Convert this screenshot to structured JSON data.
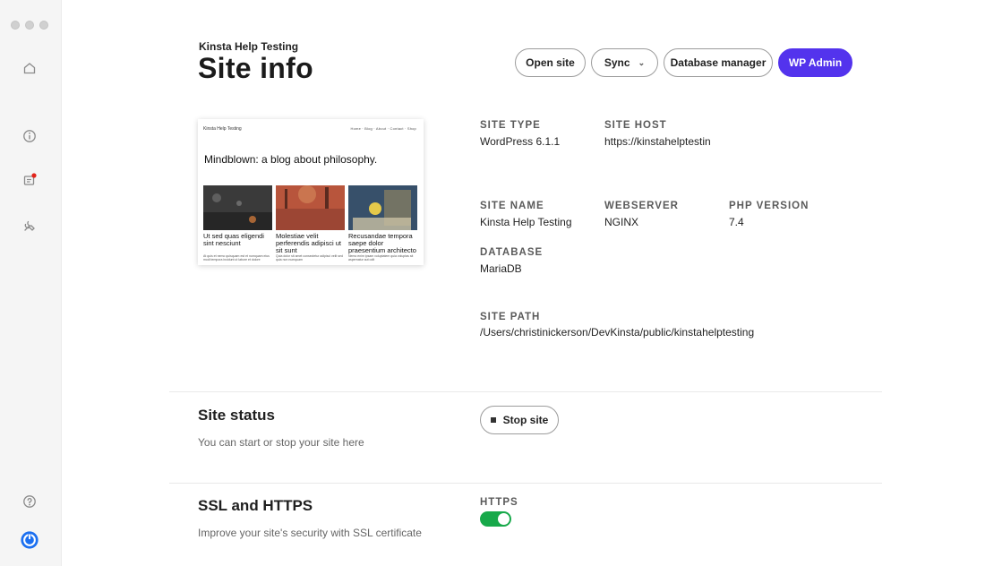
{
  "window": {
    "title": "Kinsta Help Testing — Site info"
  },
  "sidebar": {
    "items": [
      {
        "icon": "home-icon"
      },
      {
        "icon": "info-icon"
      },
      {
        "icon": "sites-icon",
        "badge": true
      },
      {
        "icon": "tools-icon"
      },
      {
        "icon": "help-icon"
      },
      {
        "icon": "kinsta-logo-icon"
      }
    ]
  },
  "header": {
    "breadcrumb": "Kinsta Help Testing",
    "title": "Site info"
  },
  "actions": {
    "open_site": "Open site",
    "sync": "Sync",
    "database_manager": "Database manager",
    "wp_admin": "WP Admin"
  },
  "preview": {
    "site_title": "Kinsta Help Testing",
    "nav_text": "Home  ·  Blog  ·  About  ·  Contact  ·  Shop",
    "headline": "Mindblown: a blog about philosophy.",
    "posts": [
      {
        "title": "Ut sed quas eligendi sint nesciunt",
        "excerpt": "At quis et nemo quisquam est et numquam eius modi tempora incidunt ut labore et dolore"
      },
      {
        "title": "Molestiae velit perferendis adipisci ut sit sunt",
        "excerpt": "Quia dolor sit amet consectetur adipisci velit sed quia non numquam"
      },
      {
        "title": "Recusandae tempora saepe dolor praesentium architecto",
        "excerpt": "Nemo enim ipsam voluptatem quia voluptas sit aspernatur aut odit"
      }
    ]
  },
  "info": {
    "site_type": {
      "label": "SITE TYPE",
      "value": "WordPress 6.1.1"
    },
    "site_host": {
      "label": "SITE HOST",
      "value": "https://kinstahelptestin"
    },
    "site_name": {
      "label": "SITE NAME",
      "value": "Kinsta Help Testing"
    },
    "webserver": {
      "label": "WEBSERVER",
      "value": "NGINX"
    },
    "php_version": {
      "label": "PHP VERSION",
      "value": "7.4"
    },
    "database": {
      "label": "DATABASE",
      "value": "MariaDB"
    },
    "site_path": {
      "label": "SITE PATH",
      "value": "/Users/christinickerson/DevKinsta/public/kinstahelptesting"
    }
  },
  "site_status": {
    "title": "Site status",
    "description": "You can start or stop your site here",
    "stop_button": "Stop site"
  },
  "ssl": {
    "title": "SSL and HTTPS",
    "description": "Improve your site's security with SSL certificate",
    "https_label": "HTTPS",
    "https_enabled": true
  },
  "colors": {
    "accent": "#5333ed",
    "toggle_on": "#17a94a",
    "badge": "#e2231a"
  }
}
